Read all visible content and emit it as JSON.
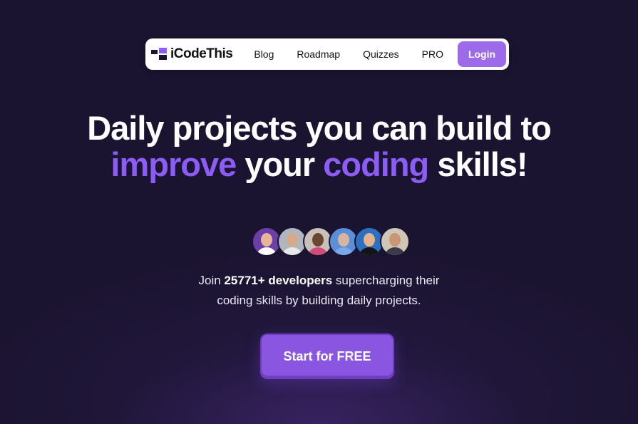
{
  "nav": {
    "logo_text": "iCodeThis",
    "links": [
      "Blog",
      "Roadmap",
      "Quizzes",
      "PRO"
    ],
    "login_label": "Login"
  },
  "hero": {
    "line1": "Daily projects you can build to",
    "word_improve": "improve",
    "word_your": "your",
    "word_coding": "coding",
    "word_skills": "skills!",
    "accent_color": "#8b5cf6"
  },
  "avatars": [
    {
      "bg": "#6b3fa8",
      "skin": "#e7b69a",
      "shirt": "#ffffff"
    },
    {
      "bg": "#aeb7bf",
      "skin": "#d9a98c",
      "shirt": "#e8e8e8"
    },
    {
      "bg": "#c9c1b8",
      "skin": "#6b4632",
      "shirt": "#d04a7a"
    },
    {
      "bg": "#5b8fd8",
      "skin": "#d7b4a0",
      "shirt": "#7aa8e8"
    },
    {
      "bg": "#2d6fc0",
      "skin": "#e2b48e",
      "shirt": "#141414"
    },
    {
      "bg": "#cfc6b5",
      "skin": "#c99676",
      "shirt": "#3a3a4a"
    }
  ],
  "join": {
    "prefix": "Join ",
    "count_label": "25771+ developers",
    "suffix_line1": " supercharging their",
    "line2": "coding skills by building daily projects."
  },
  "cta": {
    "label": "Start for FREE"
  }
}
